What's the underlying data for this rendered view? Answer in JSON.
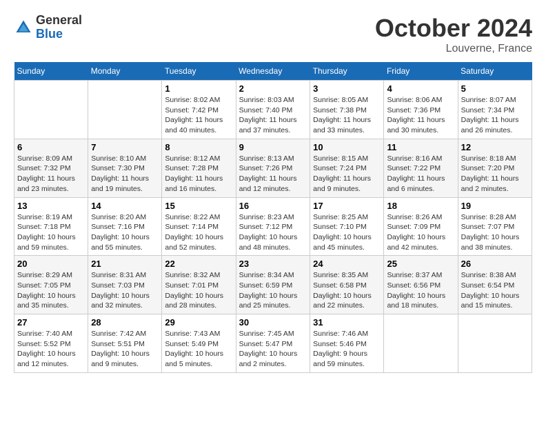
{
  "header": {
    "logo": {
      "line1": "General",
      "line2": "Blue"
    },
    "month": "October 2024",
    "location": "Louverne, France"
  },
  "weekdays": [
    "Sunday",
    "Monday",
    "Tuesday",
    "Wednesday",
    "Thursday",
    "Friday",
    "Saturday"
  ],
  "weeks": [
    [
      {
        "day": "",
        "info": ""
      },
      {
        "day": "",
        "info": ""
      },
      {
        "day": "1",
        "sunrise": "Sunrise: 8:02 AM",
        "sunset": "Sunset: 7:42 PM",
        "daylight": "Daylight: 11 hours and 40 minutes."
      },
      {
        "day": "2",
        "sunrise": "Sunrise: 8:03 AM",
        "sunset": "Sunset: 7:40 PM",
        "daylight": "Daylight: 11 hours and 37 minutes."
      },
      {
        "day": "3",
        "sunrise": "Sunrise: 8:05 AM",
        "sunset": "Sunset: 7:38 PM",
        "daylight": "Daylight: 11 hours and 33 minutes."
      },
      {
        "day": "4",
        "sunrise": "Sunrise: 8:06 AM",
        "sunset": "Sunset: 7:36 PM",
        "daylight": "Daylight: 11 hours and 30 minutes."
      },
      {
        "day": "5",
        "sunrise": "Sunrise: 8:07 AM",
        "sunset": "Sunset: 7:34 PM",
        "daylight": "Daylight: 11 hours and 26 minutes."
      }
    ],
    [
      {
        "day": "6",
        "sunrise": "Sunrise: 8:09 AM",
        "sunset": "Sunset: 7:32 PM",
        "daylight": "Daylight: 11 hours and 23 minutes."
      },
      {
        "day": "7",
        "sunrise": "Sunrise: 8:10 AM",
        "sunset": "Sunset: 7:30 PM",
        "daylight": "Daylight: 11 hours and 19 minutes."
      },
      {
        "day": "8",
        "sunrise": "Sunrise: 8:12 AM",
        "sunset": "Sunset: 7:28 PM",
        "daylight": "Daylight: 11 hours and 16 minutes."
      },
      {
        "day": "9",
        "sunrise": "Sunrise: 8:13 AM",
        "sunset": "Sunset: 7:26 PM",
        "daylight": "Daylight: 11 hours and 12 minutes."
      },
      {
        "day": "10",
        "sunrise": "Sunrise: 8:15 AM",
        "sunset": "Sunset: 7:24 PM",
        "daylight": "Daylight: 11 hours and 9 minutes."
      },
      {
        "day": "11",
        "sunrise": "Sunrise: 8:16 AM",
        "sunset": "Sunset: 7:22 PM",
        "daylight": "Daylight: 11 hours and 6 minutes."
      },
      {
        "day": "12",
        "sunrise": "Sunrise: 8:18 AM",
        "sunset": "Sunset: 7:20 PM",
        "daylight": "Daylight: 11 hours and 2 minutes."
      }
    ],
    [
      {
        "day": "13",
        "sunrise": "Sunrise: 8:19 AM",
        "sunset": "Sunset: 7:18 PM",
        "daylight": "Daylight: 10 hours and 59 minutes."
      },
      {
        "day": "14",
        "sunrise": "Sunrise: 8:20 AM",
        "sunset": "Sunset: 7:16 PM",
        "daylight": "Daylight: 10 hours and 55 minutes."
      },
      {
        "day": "15",
        "sunrise": "Sunrise: 8:22 AM",
        "sunset": "Sunset: 7:14 PM",
        "daylight": "Daylight: 10 hours and 52 minutes."
      },
      {
        "day": "16",
        "sunrise": "Sunrise: 8:23 AM",
        "sunset": "Sunset: 7:12 PM",
        "daylight": "Daylight: 10 hours and 48 minutes."
      },
      {
        "day": "17",
        "sunrise": "Sunrise: 8:25 AM",
        "sunset": "Sunset: 7:10 PM",
        "daylight": "Daylight: 10 hours and 45 minutes."
      },
      {
        "day": "18",
        "sunrise": "Sunrise: 8:26 AM",
        "sunset": "Sunset: 7:09 PM",
        "daylight": "Daylight: 10 hours and 42 minutes."
      },
      {
        "day": "19",
        "sunrise": "Sunrise: 8:28 AM",
        "sunset": "Sunset: 7:07 PM",
        "daylight": "Daylight: 10 hours and 38 minutes."
      }
    ],
    [
      {
        "day": "20",
        "sunrise": "Sunrise: 8:29 AM",
        "sunset": "Sunset: 7:05 PM",
        "daylight": "Daylight: 10 hours and 35 minutes."
      },
      {
        "day": "21",
        "sunrise": "Sunrise: 8:31 AM",
        "sunset": "Sunset: 7:03 PM",
        "daylight": "Daylight: 10 hours and 32 minutes."
      },
      {
        "day": "22",
        "sunrise": "Sunrise: 8:32 AM",
        "sunset": "Sunset: 7:01 PM",
        "daylight": "Daylight: 10 hours and 28 minutes."
      },
      {
        "day": "23",
        "sunrise": "Sunrise: 8:34 AM",
        "sunset": "Sunset: 6:59 PM",
        "daylight": "Daylight: 10 hours and 25 minutes."
      },
      {
        "day": "24",
        "sunrise": "Sunrise: 8:35 AM",
        "sunset": "Sunset: 6:58 PM",
        "daylight": "Daylight: 10 hours and 22 minutes."
      },
      {
        "day": "25",
        "sunrise": "Sunrise: 8:37 AM",
        "sunset": "Sunset: 6:56 PM",
        "daylight": "Daylight: 10 hours and 18 minutes."
      },
      {
        "day": "26",
        "sunrise": "Sunrise: 8:38 AM",
        "sunset": "Sunset: 6:54 PM",
        "daylight": "Daylight: 10 hours and 15 minutes."
      }
    ],
    [
      {
        "day": "27",
        "sunrise": "Sunrise: 7:40 AM",
        "sunset": "Sunset: 5:52 PM",
        "daylight": "Daylight: 10 hours and 12 minutes."
      },
      {
        "day": "28",
        "sunrise": "Sunrise: 7:42 AM",
        "sunset": "Sunset: 5:51 PM",
        "daylight": "Daylight: 10 hours and 9 minutes."
      },
      {
        "day": "29",
        "sunrise": "Sunrise: 7:43 AM",
        "sunset": "Sunset: 5:49 PM",
        "daylight": "Daylight: 10 hours and 5 minutes."
      },
      {
        "day": "30",
        "sunrise": "Sunrise: 7:45 AM",
        "sunset": "Sunset: 5:47 PM",
        "daylight": "Daylight: 10 hours and 2 minutes."
      },
      {
        "day": "31",
        "sunrise": "Sunrise: 7:46 AM",
        "sunset": "Sunset: 5:46 PM",
        "daylight": "Daylight: 9 hours and 59 minutes."
      },
      {
        "day": "",
        "info": ""
      },
      {
        "day": "",
        "info": ""
      }
    ]
  ]
}
